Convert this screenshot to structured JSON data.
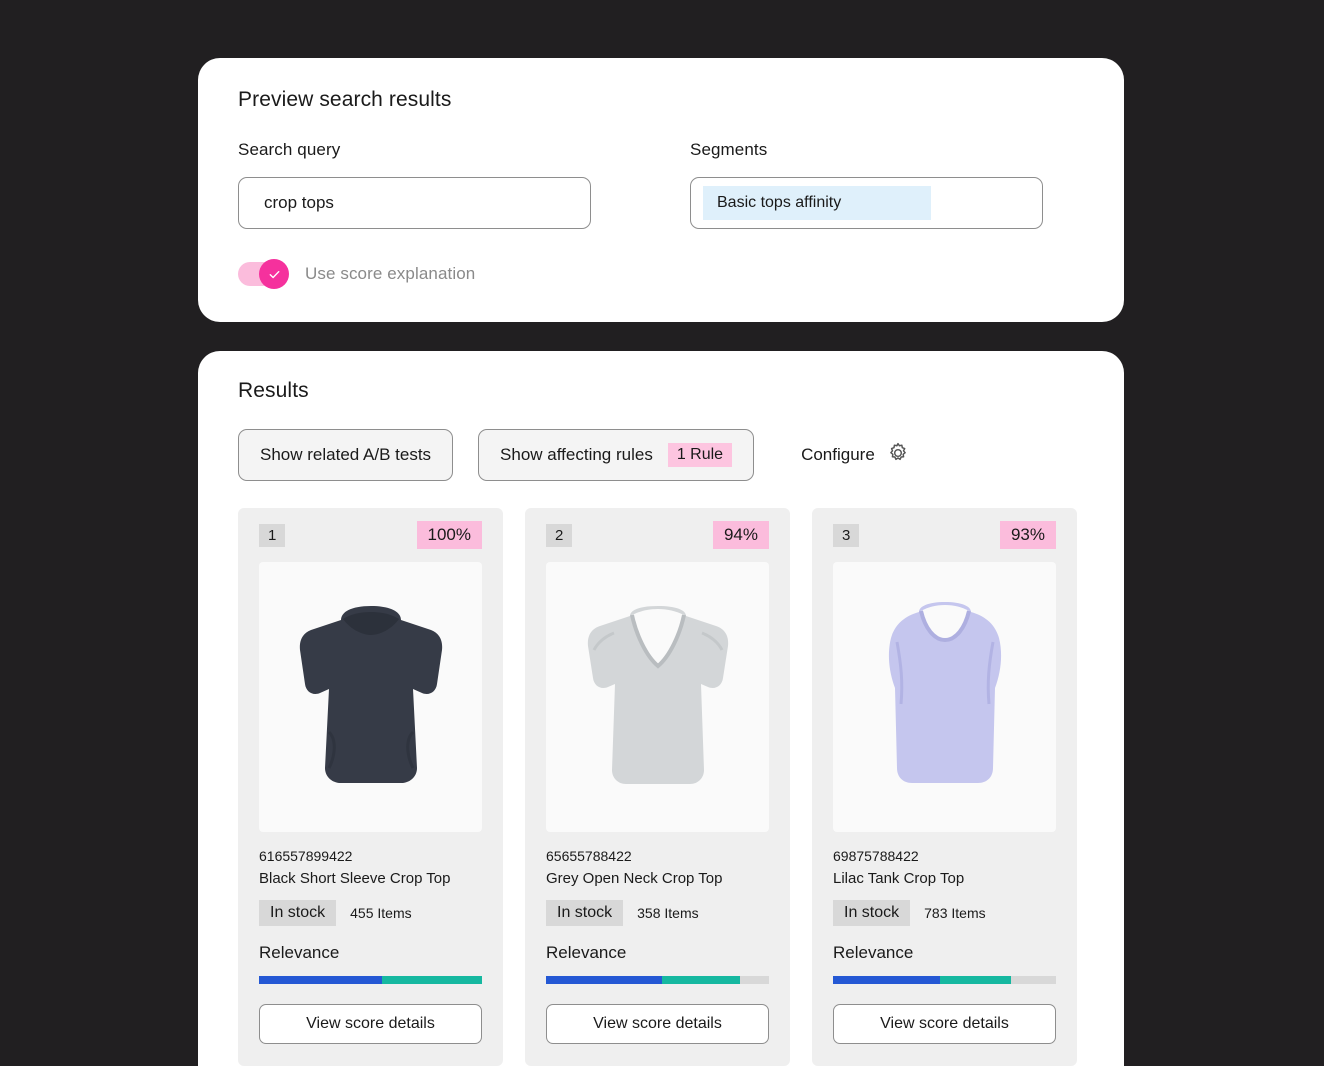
{
  "preview": {
    "title": "Preview search results",
    "search_query_label": "Search query",
    "search_query_value": "crop tops",
    "search_query_placeholder": "Search query",
    "segments_label": "Segments",
    "segment_chip": "Basic tops affinity",
    "toggle_label": "Use score explanation",
    "toggle_on": true,
    "toggle_icon": "check-icon"
  },
  "results": {
    "title": "Results",
    "ab_tests_button": "Show related A/B tests",
    "affecting_rules_button": "Show affecting rules",
    "affecting_rules_badge": "1 Rule",
    "configure_label": "Configure",
    "configure_icon": "gear-icon",
    "relevance_label": "Relevance",
    "details_button": "View score details",
    "cards": [
      {
        "rank": "1",
        "score": "100%",
        "sku": "616557899422",
        "name": "Black Short Sleeve Crop Top",
        "stock_status": "In stock",
        "stock_count": "455 Items",
        "relevance": {
          "blue_pct": 55,
          "teal_pct": 45,
          "empty_pct": 0
        },
        "image": {
          "name": "black-short-sleeve-crop-top",
          "color": "#363b47",
          "style": "cap-sleeve-tee"
        }
      },
      {
        "rank": "2",
        "score": "94%",
        "sku": "65655788422",
        "name": "Grey Open Neck Crop Top",
        "stock_status": "In stock",
        "stock_count": "358 Items",
        "relevance": {
          "blue_pct": 52,
          "teal_pct": 35,
          "empty_pct": 13
        },
        "image": {
          "name": "grey-open-neck-crop-top",
          "color": "#cfd2d4",
          "style": "v-neck-tee"
        }
      },
      {
        "rank": "3",
        "score": "93%",
        "sku": "69875788422",
        "name": "Lilac Tank Crop Top",
        "stock_status": "In stock",
        "stock_count": "783 Items",
        "relevance": {
          "blue_pct": 48,
          "teal_pct": 32,
          "empty_pct": 20
        },
        "image": {
          "name": "lilac-tank-crop-top",
          "color": "#c3c4ee",
          "style": "tank-top"
        }
      }
    ]
  },
  "colors": {
    "background": "#211f21",
    "panel": "#ffffff",
    "accent_pink": "#f5319d",
    "badge_pink": "#fbbcdc",
    "chip_blue": "#dff0fb",
    "bar_blue": "#2458d4",
    "bar_teal": "#16b8a0",
    "bar_empty": "#d8d8d8"
  }
}
